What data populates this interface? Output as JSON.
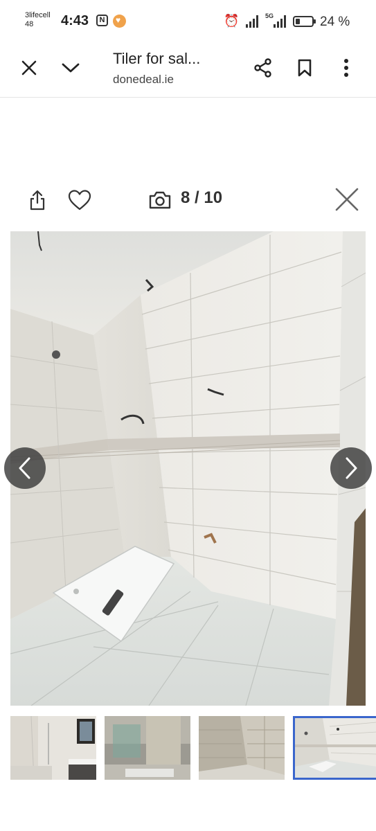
{
  "status_bar": {
    "carrier_line1": "3lifecell",
    "carrier_line2": "48",
    "time": "4:43",
    "nfc_label": "N",
    "network_label": "5G",
    "battery_percent": "24 %",
    "battery_level": 0.24
  },
  "browser": {
    "title": "Tiler for sal...",
    "url": "donedeal.ie",
    "icons": [
      "close-icon",
      "chevron-down-icon",
      "share-icon",
      "bookmark-icon",
      "more-vert-icon"
    ]
  },
  "gallery": {
    "counter": "8 / 10",
    "current_index": 8,
    "total": 10,
    "icons": [
      "share-upload-icon",
      "heart-icon",
      "camera-icon",
      "close-icon",
      "chevron-left-icon",
      "chevron-right-icon"
    ],
    "photo_description_name": "tiled-shower-room-photo",
    "thumbnails": [
      {
        "name": "thumbnail-bathroom-finished",
        "active": false
      },
      {
        "name": "thumbnail-bathroom-stripped",
        "active": false
      },
      {
        "name": "thumbnail-shower-tiles-prep",
        "active": false
      },
      {
        "name": "thumbnail-shower-tiled",
        "active": true
      }
    ]
  },
  "colors": {
    "accent_active_thumb": "#3a66cc",
    "nav_arrow_bg": "#3c3c3c"
  }
}
